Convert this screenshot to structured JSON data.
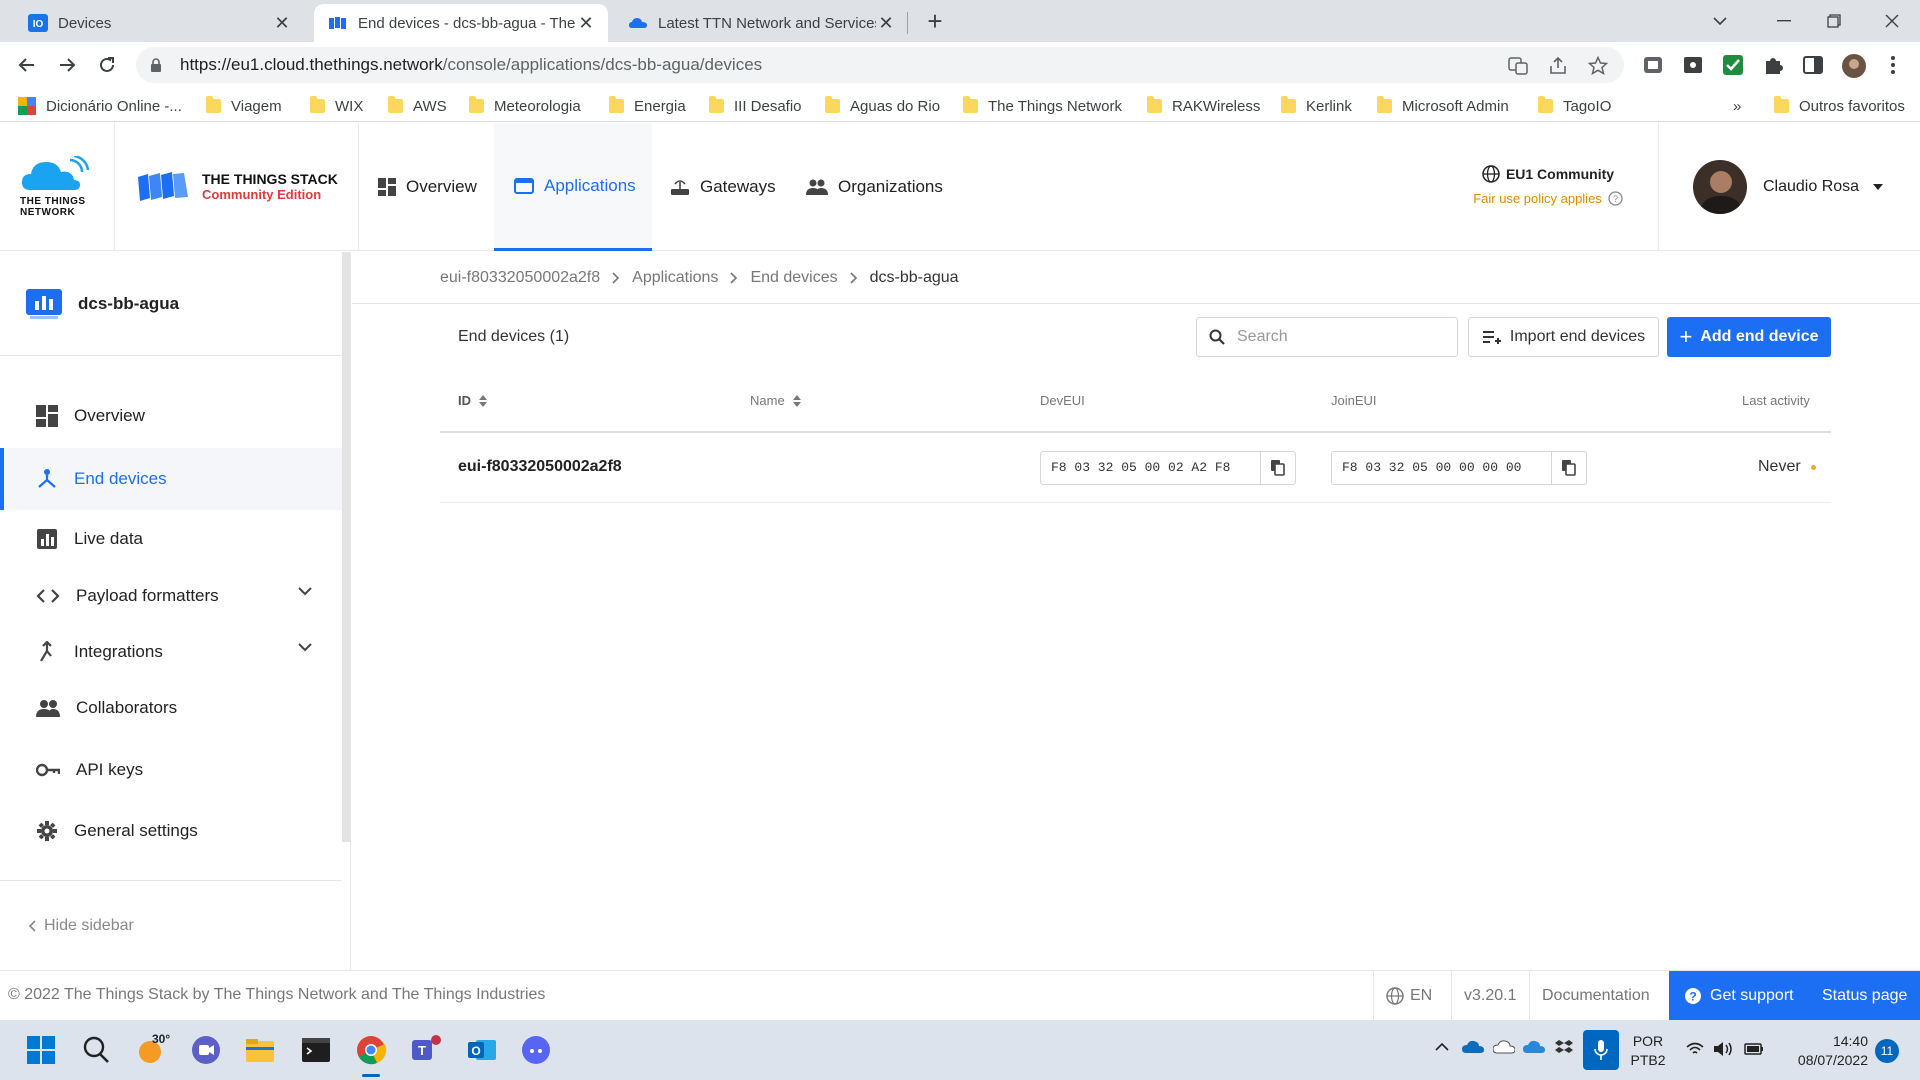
{
  "browser": {
    "tabs": [
      {
        "title": "Devices",
        "icon": "io-favicon"
      },
      {
        "title": "End devices - dcs-bb-agua - The",
        "icon": "ttn-favicon"
      },
      {
        "title": "Latest TTN Network and Services",
        "icon": "cloud-favicon"
      }
    ],
    "url_host": "https://eu1.cloud.thethings.network",
    "url_path": "/console/applications/dcs-bb-agua/devices",
    "bookmarks": [
      "Dicionário Online -...",
      "Viagem",
      "WIX",
      "AWS",
      "Meteorologia",
      "Energia",
      "III Desafio",
      "Aguas do Rio",
      "The Things Network",
      "RAKWireless",
      "Kerlink",
      "Microsoft Admin",
      "TagoIO"
    ],
    "bookmarks_overflow": "»",
    "other_bookmarks": "Outros favoritos"
  },
  "header": {
    "logo_text": [
      "THE THINGS",
      "NETWORK"
    ],
    "brand_title": "THE THINGS STACK",
    "brand_subtitle": "Community Edition",
    "nav": [
      "Overview",
      "Applications",
      "Gateways",
      "Organizations"
    ],
    "cluster": "EU1 Community",
    "fair_use": "Fair use policy applies",
    "user_name": "Claudio Rosa"
  },
  "sidebar": {
    "app_name": "dcs-bb-agua",
    "items": [
      "Overview",
      "End devices",
      "Live data",
      "Payload formatters",
      "Integrations",
      "Collaborators",
      "API keys",
      "General settings"
    ],
    "hide_label": "Hide sidebar"
  },
  "breadcrumb": [
    "eui-f80332050002a2f8",
    "Applications",
    "End devices",
    "dcs-bb-agua"
  ],
  "devices": {
    "title": "End devices (1)",
    "search_placeholder": "Search",
    "import_label": "Import end devices",
    "add_label": "Add end device",
    "columns": [
      "ID",
      "Name",
      "DevEUI",
      "JoinEUI",
      "Last activity"
    ],
    "rows": [
      {
        "id": "eui-f80332050002a2f8",
        "dev_eui": "F8 03 32 05 00 02 A2 F8",
        "join_eui": "F8 03 32 05 00 00 00 00",
        "last_activity": "Never"
      }
    ]
  },
  "footer": {
    "copyright": "© 2022 The Things Stack by The Things Network and The Things Industries",
    "language": "EN",
    "version": "v3.20.1",
    "documentation": "Documentation",
    "support": "Get support",
    "status": "Status page"
  },
  "taskbar": {
    "weather": "30°",
    "lang_top": "POR",
    "lang_bottom": "PTB2",
    "time": "14:40",
    "date": "08/07/2022",
    "notifications": "11"
  },
  "colors": {
    "accent": "#1c6ef2",
    "warning": "#f5a623"
  }
}
